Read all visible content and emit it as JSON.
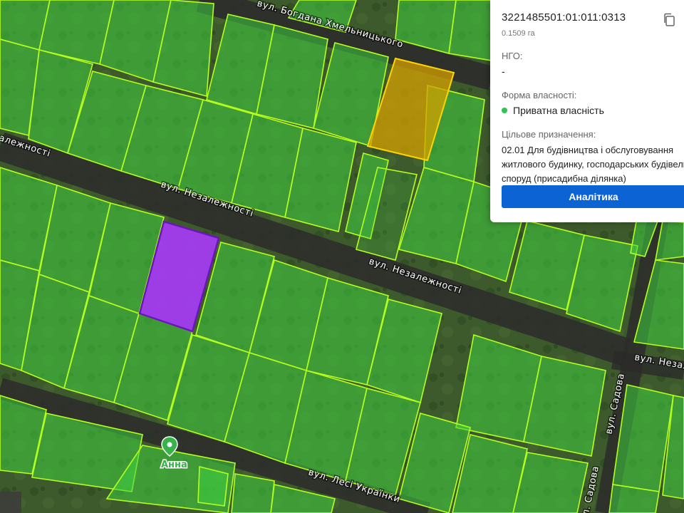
{
  "parcel": {
    "cadastral_number": "3221485501:01:011:0313",
    "area": "0.1509 га",
    "ngo_label": "НГО:",
    "ngo_value": "-",
    "ownership_label": "Форма власності:",
    "ownership_value": "Приватна власність",
    "ownership_color": "#2dc653",
    "purpose_label": "Цільове призначення:",
    "purpose_line1": "02.01 Для будівництва і обслуговування",
    "purpose_line2": "житлового будинку, господарських будівель і",
    "purpose_line3": "споруд (присадибна ділянка)",
    "analytics_button": "Аналітика",
    "copy_icon": "copy-icon"
  },
  "map": {
    "streets": {
      "khmelnytskoho": "вул. Богдана Хмельницького",
      "nezalezhnosti_left": "вул. Незалежності",
      "nezalezhnosti_main": "вул. Незалежності",
      "nezalezhnosti_right": "вул. Незалежності",
      "nezalezhnosti_edge": "вул. Незалежності",
      "sadova": "вул. Садова",
      "lesi": "вул. Лесі Українки",
      "right_bottom": "вул. Садова"
    },
    "poi": {
      "name": "Анна",
      "icon": "map-pin-icon",
      "color": "#38b24a"
    },
    "selected_parcel_color": "#a33cf0",
    "highlight_parcel_color": "#d4a000",
    "parcel_fill": "#3fd13f",
    "parcel_outline": "#b6ff1e"
  }
}
